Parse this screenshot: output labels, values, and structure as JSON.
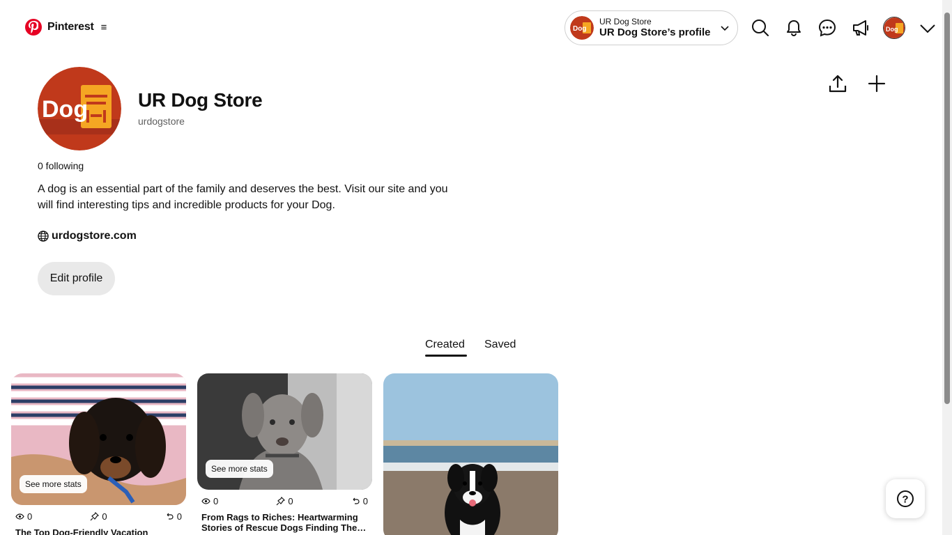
{
  "header": {
    "brand": "Pinterest",
    "menu_glyph": "≡",
    "account": {
      "name": "UR Dog Store",
      "profile_label": "UR Dog Store’s profile"
    },
    "icons": [
      "search-icon",
      "bell-icon",
      "message-icon",
      "megaphone-icon",
      "avatar",
      "chevron-down-icon"
    ]
  },
  "profile": {
    "avatar_text": "Dog",
    "name": "UR Dog Store",
    "handle": "urdogstore",
    "following": "0 following",
    "bio": "A dog is an essential part of the family and deserves the best. Visit our site and you will find interesting tips and incredible products for your Dog.",
    "website": "urdogstore.com",
    "edit_label": "Edit profile"
  },
  "tabs": {
    "created": "Created",
    "saved": "Saved",
    "active": "Created"
  },
  "pins": [
    {
      "stats_label": "See more stats",
      "views": "0",
      "saves": "0",
      "clicks": "0",
      "title": "The Top Dog-Friendly Vacation"
    },
    {
      "stats_label": "See more stats",
      "views": "0",
      "saves": "0",
      "clicks": "0",
      "title": "From Rags to Riches: Heartwarming Stories of Rescue Dogs Finding The…"
    },
    {
      "stats_label": "",
      "views": "",
      "saves": "",
      "clicks": "",
      "title": ""
    }
  ],
  "help": {
    "glyph": "?"
  },
  "colors": {
    "brand": "#e60023",
    "avatar_bg": "#c0391b",
    "avatar_accent": "#f5a623"
  }
}
